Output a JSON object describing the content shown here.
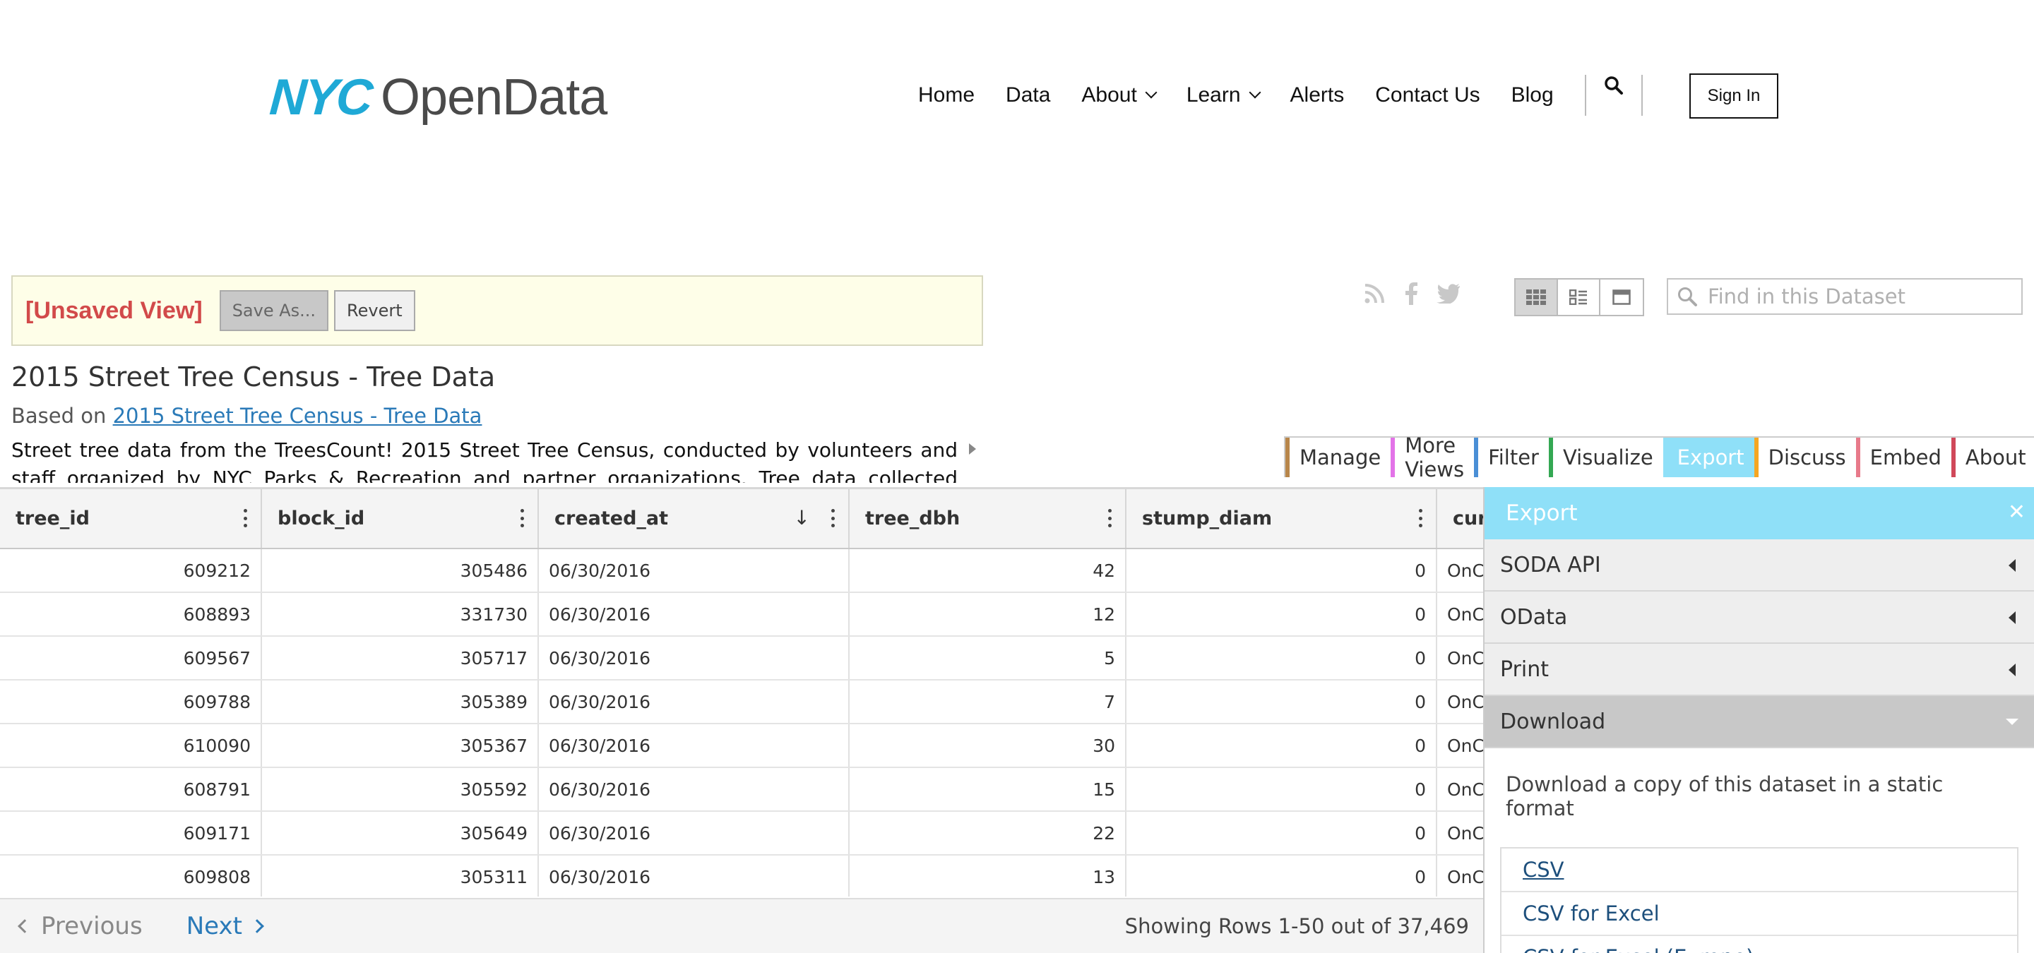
{
  "header": {
    "logo": {
      "nyc": "NYC",
      "name": "OpenData"
    },
    "nav": [
      "Home",
      "Data",
      "About",
      "Learn",
      "Alerts",
      "Contact Us",
      "Blog"
    ],
    "sign_in": "Sign In"
  },
  "view_bar": {
    "unsaved": "[Unsaved View]",
    "save_as": "Save As...",
    "revert": "Revert"
  },
  "find": {
    "placeholder": "Find in this Dataset"
  },
  "dataset": {
    "title": "2015 Street Tree Census - Tree Data",
    "based_on_prefix": "Based on",
    "based_on_link": "2015 Street Tree Census - Tree Data",
    "description": "Street tree data from the TreesCount! 2015 Street Tree Census, conducted by volunteers and staff organized by NYC Parks & Recreation and partner organizations. Tree data collected includes tree"
  },
  "sidebar_tabs": [
    {
      "label": "Manage",
      "color": "#b8864a"
    },
    {
      "label": "More Views",
      "color": "#e373e8"
    },
    {
      "label": "Filter",
      "color": "#4a8fd6"
    },
    {
      "label": "Visualize",
      "color": "#34a853"
    },
    {
      "label": "Export",
      "color": "#8fe0f8",
      "active": true
    },
    {
      "label": "Discuss",
      "color": "#f5a623"
    },
    {
      "label": "Embed",
      "color": "#e87a8a"
    },
    {
      "label": "About",
      "color": "#d0485a"
    }
  ],
  "table": {
    "columns": [
      "tree_id",
      "block_id",
      "created_at",
      "tree_dbh",
      "stump_diam",
      "curb_loc"
    ],
    "sorted_column": "created_at",
    "rows": [
      [
        "609212",
        "305486",
        "06/30/2016",
        "42",
        "0",
        "OnCurb"
      ],
      [
        "608893",
        "331730",
        "06/30/2016",
        "12",
        "0",
        "OnCurb"
      ],
      [
        "609567",
        "305717",
        "06/30/2016",
        "5",
        "0",
        "OnCurb"
      ],
      [
        "609788",
        "305389",
        "06/30/2016",
        "7",
        "0",
        "OnCurb"
      ],
      [
        "610090",
        "305367",
        "06/30/2016",
        "30",
        "0",
        "OnCurb"
      ],
      [
        "608791",
        "305592",
        "06/30/2016",
        "15",
        "0",
        "OnCurb"
      ],
      [
        "609171",
        "305649",
        "06/30/2016",
        "22",
        "0",
        "OnCurb"
      ],
      [
        "609808",
        "305311",
        "06/30/2016",
        "13",
        "0",
        "OnCurb"
      ]
    ]
  },
  "pager": {
    "previous": "Previous",
    "next": "Next",
    "info": "Showing Rows 1-50 out of 37,469"
  },
  "export_pane": {
    "title": "Export",
    "sections": [
      "SODA API",
      "OData",
      "Print",
      "Download"
    ],
    "download_desc": "Download a copy of this dataset in a static format",
    "download_options": [
      "CSV",
      "CSV for Excel",
      "CSV for Excel (Europe)"
    ]
  }
}
